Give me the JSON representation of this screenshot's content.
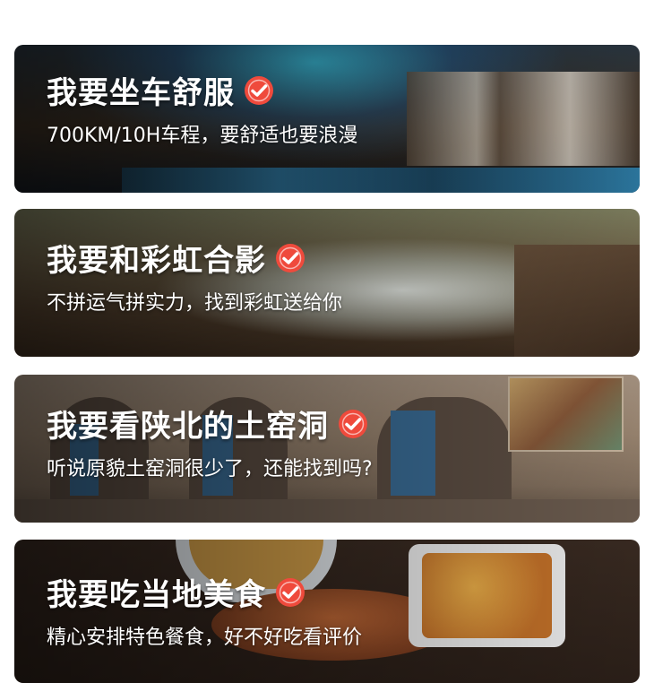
{
  "cards": [
    {
      "title": "我要坐车舒服",
      "subtitle": "700KM/10H车程，要舒适也要浪漫",
      "check_icon": "check-badge-icon"
    },
    {
      "title": "我要和彩虹合影",
      "subtitle": "不拼运气拼实力，找到彩虹送给你",
      "check_icon": "check-badge-icon"
    },
    {
      "title": "我要看陕北的土窑洞",
      "subtitle": "听说原貌土窑洞很少了，还能找到吗?",
      "check_icon": "check-badge-icon"
    },
    {
      "title": "我要吃当地美食",
      "subtitle": "精心安排特色餐食，好不好吃看评价",
      "check_icon": "check-badge-icon"
    }
  ],
  "colors": {
    "check_badge": "#ef4a3c",
    "text": "#ffffff"
  }
}
